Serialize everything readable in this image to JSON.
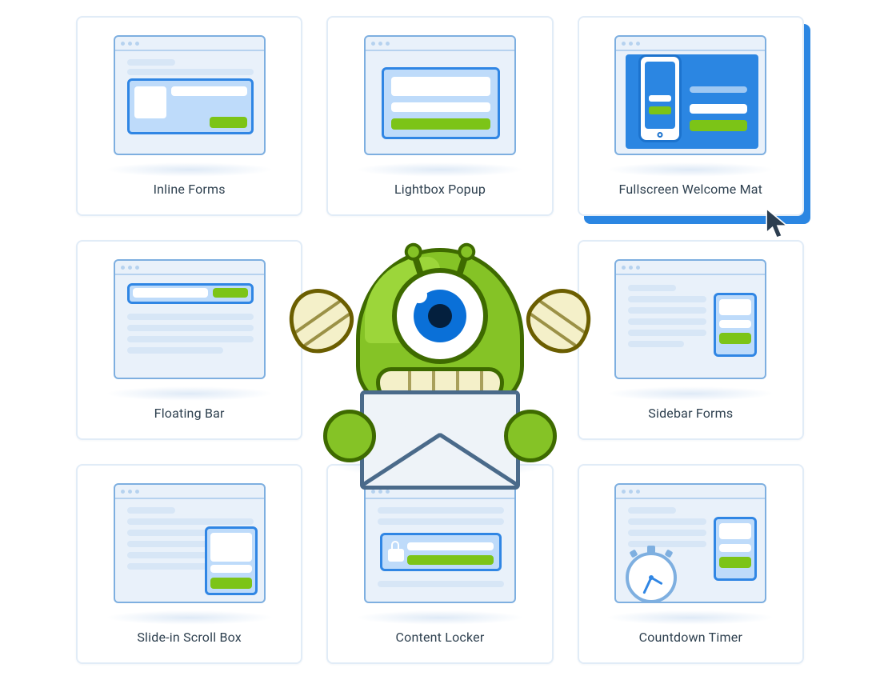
{
  "cards": [
    {
      "id": "inline-forms",
      "label": "Inline Forms"
    },
    {
      "id": "lightbox-popup",
      "label": "Lightbox Popup"
    },
    {
      "id": "fullscreen-welcome",
      "label": "Fullscreen Welcome Mat",
      "hovered": true
    },
    {
      "id": "floating-bar",
      "label": "Floating Bar"
    },
    {
      "id": "mascot-center",
      "label": ""
    },
    {
      "id": "sidebar-forms",
      "label": "Sidebar Forms"
    },
    {
      "id": "slidein-scroll-box",
      "label": "Slide-in Scroll Box"
    },
    {
      "id": "content-locker",
      "label": "Content Locker"
    },
    {
      "id": "countdown-timer",
      "label": "Countdown Timer"
    }
  ],
  "mascot": {
    "name": "optinmonster-mascot",
    "holding": "envelope",
    "colors": {
      "body": "#85C326",
      "outline": "#3E6A00",
      "horn": "#F4F0C9",
      "iris": "#0A70D8"
    }
  },
  "cursor": {
    "target": "fullscreen-welcome"
  },
  "palette": {
    "cardBorder": "#E1ECF7",
    "frame": "#7EAFE0",
    "blue": "#2B86E2",
    "green": "#7CC417",
    "text": "#2E404F"
  }
}
